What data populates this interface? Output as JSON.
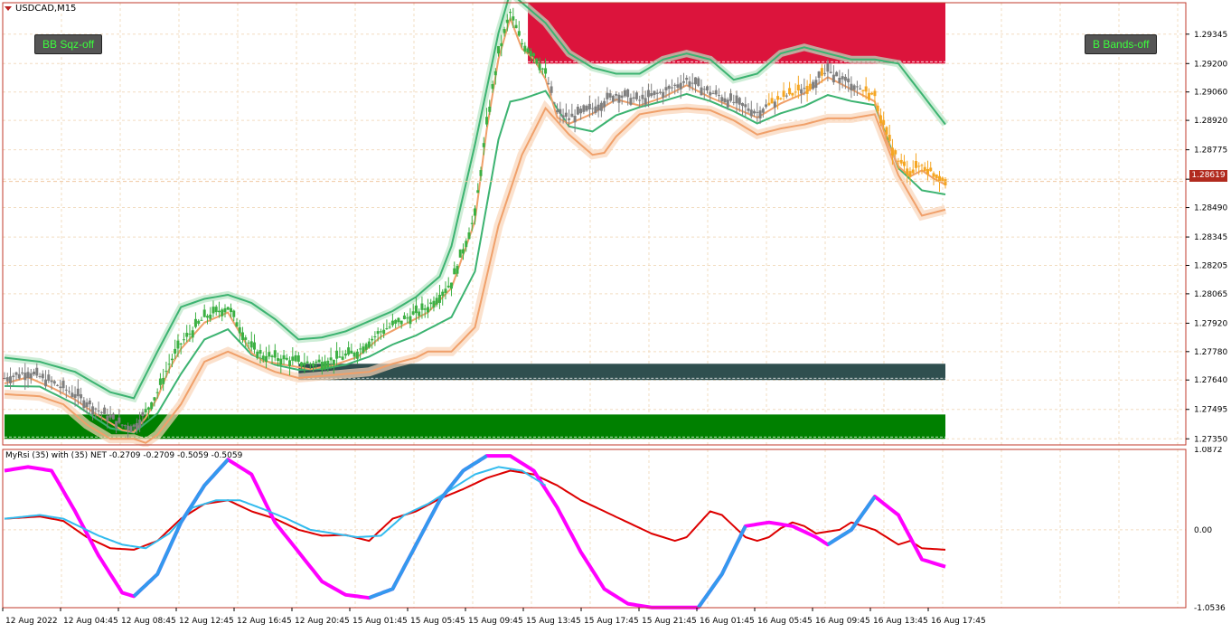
{
  "title": {
    "symbol": "USDCAD,M15"
  },
  "buttons": {
    "bb_sqz": "BB Sqz-off",
    "b_bands": "B Bands-off"
  },
  "current_price": "1.28619",
  "indicator": {
    "label": "MyRsi (35) with (35) NET -0.2709 -0.2709 -0.5059 -0.5059"
  },
  "colors": {
    "background": "#ffffff",
    "grid": "#f2dcc0",
    "border": "#c0392b",
    "bull_candle": "#3cb043",
    "neutral_candle": "#7f7f7f",
    "bear_candle": "#f5a623",
    "upper_band": "#3cb371",
    "lower_band": "#f0a06a",
    "mid_line": "#b0b0b0",
    "zone_green": "#008000",
    "zone_dark": "#2f4f4f",
    "zone_red": "#dc143c",
    "rsi_magenta": "#ff00ff",
    "rsi_blue": "#3399ee",
    "rsi_cyan": "#33bbee",
    "rsi_red": "#dd0000"
  },
  "chart_data": [
    {
      "type": "candlestick",
      "title": "USDCAD,M15",
      "price_ticks": [
        "1.29345",
        "1.29200",
        "1.29060",
        "1.28920",
        "1.28775",
        "1.28630",
        "1.28490",
        "1.28345",
        "1.28205",
        "1.28065",
        "1.27920",
        "1.27780",
        "1.27640",
        "1.27495",
        "1.27350"
      ],
      "time_ticks": [
        "12 Aug 2022",
        "12 Aug 04:45",
        "12 Aug 08:45",
        "12 Aug 12:45",
        "12 Aug 16:45",
        "12 Aug 20:45",
        "15 Aug 01:45",
        "15 Aug 05:45",
        "15 Aug 09:45",
        "15 Aug 13:45",
        "15 Aug 17:45",
        "15 Aug 21:45",
        "16 Aug 01:45",
        "16 Aug 05:45",
        "16 Aug 09:45",
        "16 Aug 13:45",
        "16 Aug 17:45"
      ],
      "ylim": [
        1.2732,
        1.295
      ],
      "current_price": 1.28619,
      "close_path": [
        [
          0,
          1.2765
        ],
        [
          2,
          1.2768
        ],
        [
          4,
          1.2763
        ],
        [
          6,
          1.2757
        ],
        [
          8,
          1.2749
        ],
        [
          10,
          1.2742
        ],
        [
          11,
          1.2741
        ],
        [
          12,
          1.2748
        ],
        [
          13,
          1.2758
        ],
        [
          14,
          1.2772
        ],
        [
          15,
          1.2782
        ],
        [
          17,
          1.2795
        ],
        [
          19,
          1.28
        ],
        [
          20,
          1.279
        ],
        [
          21,
          1.278
        ],
        [
          22,
          1.2776
        ],
        [
          24,
          1.2774
        ],
        [
          26,
          1.2772
        ],
        [
          28,
          1.2774
        ],
        [
          30,
          1.2778
        ],
        [
          32,
          1.2788
        ],
        [
          34,
          1.2794
        ],
        [
          36,
          1.28
        ],
        [
          38,
          1.2812
        ],
        [
          40,
          1.2845
        ],
        [
          41,
          1.289
        ],
        [
          42,
          1.2925
        ],
        [
          43,
          1.2945
        ],
        [
          44,
          1.293
        ],
        [
          45,
          1.2925
        ],
        [
          46,
          1.2915
        ],
        [
          47,
          1.2896
        ],
        [
          48,
          1.2893
        ],
        [
          50,
          1.2898
        ],
        [
          52,
          1.2905
        ],
        [
          54,
          1.2902
        ],
        [
          56,
          1.2906
        ],
        [
          58,
          1.2912
        ],
        [
          60,
          1.2906
        ],
        [
          62,
          1.2901
        ],
        [
          64,
          1.2896
        ],
        [
          66,
          1.2903
        ],
        [
          68,
          1.2908
        ],
        [
          70,
          1.2916
        ],
        [
          72,
          1.291
        ],
        [
          74,
          1.2904
        ],
        [
          75,
          1.2885
        ],
        [
          76,
          1.2872
        ],
        [
          77,
          1.2867
        ],
        [
          78,
          1.287
        ],
        [
          79,
          1.2866
        ],
        [
          80,
          1.2863
        ]
      ],
      "upper_band": [
        [
          0,
          1.2775
        ],
        [
          3,
          1.2773
        ],
        [
          6,
          1.2768
        ],
        [
          9,
          1.2758
        ],
        [
          11,
          1.2755
        ],
        [
          13,
          1.2778
        ],
        [
          15,
          1.28
        ],
        [
          17,
          1.2804
        ],
        [
          19,
          1.2806
        ],
        [
          21,
          1.2802
        ],
        [
          23,
          1.2794
        ],
        [
          25,
          1.2784
        ],
        [
          27,
          1.2785
        ],
        [
          29,
          1.2788
        ],
        [
          31,
          1.2793
        ],
        [
          33,
          1.2798
        ],
        [
          35,
          1.2805
        ],
        [
          37,
          1.2815
        ],
        [
          38,
          1.283
        ],
        [
          40,
          1.288
        ],
        [
          42,
          1.2935
        ],
        [
          43,
          1.2955
        ],
        [
          44,
          1.295
        ],
        [
          46,
          1.294
        ],
        [
          48,
          1.2925
        ],
        [
          50,
          1.2918
        ],
        [
          52,
          1.2915
        ],
        [
          54,
          1.2915
        ],
        [
          56,
          1.2922
        ],
        [
          58,
          1.2925
        ],
        [
          60,
          1.2922
        ],
        [
          62,
          1.2912
        ],
        [
          64,
          1.2915
        ],
        [
          66,
          1.2925
        ],
        [
          68,
          1.2928
        ],
        [
          70,
          1.2925
        ],
        [
          72,
          1.2922
        ],
        [
          74,
          1.2922
        ],
        [
          76,
          1.292
        ],
        [
          78,
          1.2905
        ],
        [
          80,
          1.289
        ]
      ],
      "lower_band": [
        [
          0,
          1.2757
        ],
        [
          3,
          1.2756
        ],
        [
          5,
          1.2752
        ],
        [
          7,
          1.2742
        ],
        [
          9,
          1.2735
        ],
        [
          11,
          1.2735
        ],
        [
          12,
          1.2733
        ],
        [
          13,
          1.2737
        ],
        [
          15,
          1.2752
        ],
        [
          17,
          1.2773
        ],
        [
          19,
          1.2778
        ],
        [
          21,
          1.2773
        ],
        [
          23,
          1.2768
        ],
        [
          25,
          1.2765
        ],
        [
          27,
          1.2766
        ],
        [
          29,
          1.2767
        ],
        [
          31,
          1.2768
        ],
        [
          33,
          1.2772
        ],
        [
          35,
          1.2775
        ],
        [
          36,
          1.2778
        ],
        [
          38,
          1.2778
        ],
        [
          40,
          1.279
        ],
        [
          42,
          1.284
        ],
        [
          44,
          1.2875
        ],
        [
          46,
          1.2898
        ],
        [
          48,
          1.2885
        ],
        [
          50,
          1.2875
        ],
        [
          51,
          1.2876
        ],
        [
          52,
          1.2884
        ],
        [
          54,
          1.2895
        ],
        [
          56,
          1.2897
        ],
        [
          58,
          1.2898
        ],
        [
          60,
          1.2897
        ],
        [
          62,
          1.2892
        ],
        [
          64,
          1.2885
        ],
        [
          66,
          1.2888
        ],
        [
          68,
          1.289
        ],
        [
          70,
          1.2893
        ],
        [
          72,
          1.2893
        ],
        [
          74,
          1.2895
        ],
        [
          76,
          1.2865
        ],
        [
          78,
          1.2845
        ],
        [
          80,
          1.2848
        ]
      ],
      "zones": [
        {
          "color": "zone_green",
          "from_x": 0,
          "to_x": 80,
          "y_top": 1.2747,
          "y_bottom": 1.2735
        },
        {
          "color": "zone_dark",
          "from_x": 25,
          "to_x": 80,
          "y_top": 1.2772,
          "y_bottom": 1.2764
        },
        {
          "color": "zone_red",
          "from_x": 44.5,
          "to_x": 80,
          "y_top": 1.295,
          "y_bottom": 1.292
        }
      ]
    },
    {
      "type": "line",
      "title": "MyRsi (35) with (35) NET -0.2709 -0.2709 -0.5059 -0.5059",
      "y_ticks": [
        "1.0872",
        "0.00",
        "-1.0536"
      ],
      "ylim": [
        -1.0536,
        1.0872
      ],
      "series": [
        {
          "color": "rsi_red",
          "values": [
            [
              0,
              0.15
            ],
            [
              3,
              0.18
            ],
            [
              5,
              0.12
            ],
            [
              7,
              -0.1
            ],
            [
              9,
              -0.25
            ],
            [
              11,
              -0.27
            ],
            [
              13,
              -0.15
            ],
            [
              15,
              0.15
            ],
            [
              17,
              0.35
            ],
            [
              19,
              0.4
            ],
            [
              21,
              0.25
            ],
            [
              23,
              0.15
            ],
            [
              25,
              0.0
            ],
            [
              27,
              -0.08
            ],
            [
              29,
              -0.07
            ],
            [
              31,
              -0.15
            ],
            [
              33,
              0.15
            ],
            [
              35,
              0.25
            ],
            [
              37,
              0.42
            ],
            [
              39,
              0.55
            ],
            [
              41,
              0.7
            ],
            [
              43,
              0.8
            ],
            [
              45,
              0.75
            ],
            [
              47,
              0.6
            ],
            [
              49,
              0.4
            ],
            [
              51,
              0.25
            ],
            [
              53,
              0.1
            ],
            [
              55,
              -0.05
            ],
            [
              57,
              -0.15
            ],
            [
              58,
              -0.1
            ],
            [
              60,
              0.25
            ],
            [
              61,
              0.2
            ],
            [
              62,
              0.05
            ],
            [
              63,
              -0.1
            ],
            [
              64,
              -0.15
            ],
            [
              65,
              -0.1
            ],
            [
              66,
              0.02
            ],
            [
              67,
              0.1
            ],
            [
              68,
              0.05
            ],
            [
              69,
              -0.05
            ],
            [
              71,
              0.0
            ],
            [
              72,
              0.1
            ],
            [
              73,
              0.05
            ],
            [
              74,
              0.0
            ],
            [
              75,
              -0.1
            ],
            [
              76,
              -0.2
            ],
            [
              77,
              -0.15
            ],
            [
              78,
              -0.25
            ],
            [
              80,
              -0.27
            ]
          ]
        },
        {
          "color": "rsi_magenta",
          "values": [
            [
              0,
              0.8
            ],
            [
              2,
              0.85
            ],
            [
              4,
              0.8
            ],
            [
              6,
              0.25
            ],
            [
              8,
              -0.35
            ],
            [
              10,
              -0.85
            ],
            [
              11,
              -0.9
            ],
            [
              13,
              -0.6
            ],
            [
              15,
              0.1
            ],
            [
              17,
              0.6
            ],
            [
              19,
              0.95
            ],
            [
              21,
              0.75
            ],
            [
              23,
              0.1
            ],
            [
              25,
              -0.3
            ],
            [
              27,
              -0.7
            ],
            [
              29,
              -0.88
            ],
            [
              31,
              -0.92
            ],
            [
              33,
              -0.8
            ],
            [
              35,
              -0.2
            ],
            [
              37,
              0.4
            ],
            [
              39,
              0.8
            ],
            [
              41,
              1.0
            ],
            [
              43,
              1.0
            ],
            [
              45,
              0.8
            ],
            [
              47,
              0.3
            ],
            [
              49,
              -0.3
            ],
            [
              51,
              -0.8
            ],
            [
              53,
              -1.0
            ],
            [
              55,
              -1.05
            ],
            [
              57,
              -1.05
            ],
            [
              59,
              -1.05
            ],
            [
              61,
              -0.6
            ],
            [
              63,
              0.05
            ],
            [
              65,
              0.1
            ],
            [
              67,
              0.05
            ],
            [
              69,
              -0.1
            ],
            [
              70,
              -0.2
            ],
            [
              72,
              0.0
            ],
            [
              74,
              0.45
            ],
            [
              76,
              0.2
            ],
            [
              78,
              -0.4
            ],
            [
              80,
              -0.5
            ]
          ]
        },
        {
          "color": "rsi_cyan",
          "values": [
            [
              0,
              0.15
            ],
            [
              3,
              0.2
            ],
            [
              5,
              0.15
            ],
            [
              8,
              -0.08
            ],
            [
              10,
              -0.2
            ],
            [
              12,
              -0.25
            ],
            [
              14,
              -0.05
            ],
            [
              16,
              0.3
            ],
            [
              18,
              0.4
            ],
            [
              20,
              0.4
            ],
            [
              22,
              0.28
            ],
            [
              24,
              0.15
            ],
            [
              26,
              0.0
            ],
            [
              28,
              -0.05
            ],
            [
              30,
              -0.1
            ],
            [
              32,
              -0.08
            ],
            [
              34,
              0.2
            ],
            [
              36,
              0.35
            ],
            [
              38,
              0.55
            ],
            [
              40,
              0.75
            ],
            [
              42,
              0.85
            ],
            [
              44,
              0.8
            ],
            [
              46,
              0.6
            ]
          ]
        }
      ]
    }
  ]
}
